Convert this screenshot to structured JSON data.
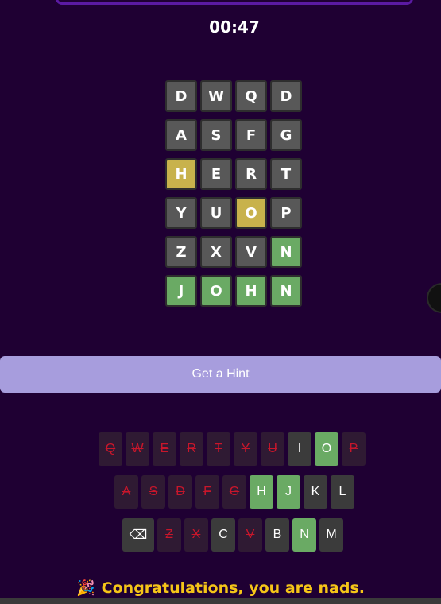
{
  "timer": "00:47",
  "board": {
    "rows": [
      [
        {
          "letter": "D",
          "state": "gray"
        },
        {
          "letter": "W",
          "state": "gray"
        },
        {
          "letter": "Q",
          "state": "gray"
        },
        {
          "letter": "D",
          "state": "gray"
        }
      ],
      [
        {
          "letter": "A",
          "state": "gray"
        },
        {
          "letter": "S",
          "state": "gray"
        },
        {
          "letter": "F",
          "state": "gray"
        },
        {
          "letter": "G",
          "state": "gray"
        }
      ],
      [
        {
          "letter": "H",
          "state": "yellow"
        },
        {
          "letter": "E",
          "state": "gray"
        },
        {
          "letter": "R",
          "state": "gray"
        },
        {
          "letter": "T",
          "state": "gray"
        }
      ],
      [
        {
          "letter": "Y",
          "state": "gray"
        },
        {
          "letter": "U",
          "state": "gray"
        },
        {
          "letter": "O",
          "state": "yellow"
        },
        {
          "letter": "P",
          "state": "gray"
        }
      ],
      [
        {
          "letter": "Z",
          "state": "gray"
        },
        {
          "letter": "X",
          "state": "gray"
        },
        {
          "letter": "V",
          "state": "gray"
        },
        {
          "letter": "N",
          "state": "green"
        }
      ],
      [
        {
          "letter": "J",
          "state": "green"
        },
        {
          "letter": "O",
          "state": "green"
        },
        {
          "letter": "H",
          "state": "green"
        },
        {
          "letter": "N",
          "state": "green"
        }
      ]
    ]
  },
  "hint_button": {
    "label": "Get a Hint"
  },
  "keyboard": {
    "rows": [
      [
        {
          "key": "Q",
          "state": "eliminated"
        },
        {
          "key": "W",
          "state": "eliminated"
        },
        {
          "key": "E",
          "state": "eliminated"
        },
        {
          "key": "R",
          "state": "eliminated"
        },
        {
          "key": "T",
          "state": "eliminated"
        },
        {
          "key": "Y",
          "state": "eliminated"
        },
        {
          "key": "U",
          "state": "eliminated"
        },
        {
          "key": "I",
          "state": "unused"
        },
        {
          "key": "O",
          "state": "green"
        },
        {
          "key": "P",
          "state": "eliminated"
        }
      ],
      [
        {
          "key": "A",
          "state": "eliminated"
        },
        {
          "key": "S",
          "state": "eliminated"
        },
        {
          "key": "D",
          "state": "eliminated"
        },
        {
          "key": "F",
          "state": "eliminated"
        },
        {
          "key": "G",
          "state": "eliminated"
        },
        {
          "key": "H",
          "state": "green"
        },
        {
          "key": "J",
          "state": "green"
        },
        {
          "key": "K",
          "state": "unused"
        },
        {
          "key": "L",
          "state": "unused"
        }
      ],
      [
        {
          "key": "⌫",
          "state": "unused",
          "wide": true
        },
        {
          "key": "Z",
          "state": "eliminated"
        },
        {
          "key": "X",
          "state": "eliminated"
        },
        {
          "key": "C",
          "state": "unused"
        },
        {
          "key": "V",
          "state": "eliminated"
        },
        {
          "key": "B",
          "state": "unused"
        },
        {
          "key": "N",
          "state": "green"
        },
        {
          "key": "M",
          "state": "unused"
        }
      ]
    ]
  },
  "message": {
    "emoji": "🎉",
    "text": "Congratulations, you are nads."
  },
  "colors": {
    "background": "#1f0033",
    "green": "#6aaa64",
    "yellow": "#c8b24c",
    "gray": "#585858",
    "eliminated_text": "#c8162b",
    "message": "#f5c518"
  }
}
